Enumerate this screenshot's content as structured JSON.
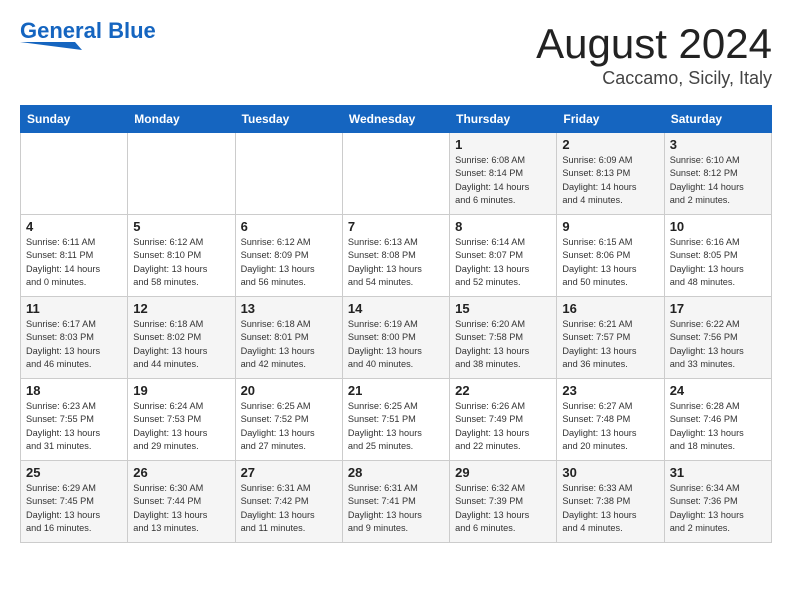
{
  "header": {
    "logo_line1": "General",
    "logo_line2": "Blue",
    "month": "August 2024",
    "location": "Caccamo, Sicily, Italy"
  },
  "weekdays": [
    "Sunday",
    "Monday",
    "Tuesday",
    "Wednesday",
    "Thursday",
    "Friday",
    "Saturday"
  ],
  "weeks": [
    [
      {
        "day": "",
        "info": ""
      },
      {
        "day": "",
        "info": ""
      },
      {
        "day": "",
        "info": ""
      },
      {
        "day": "",
        "info": ""
      },
      {
        "day": "1",
        "info": "Sunrise: 6:08 AM\nSunset: 8:14 PM\nDaylight: 14 hours\nand 6 minutes."
      },
      {
        "day": "2",
        "info": "Sunrise: 6:09 AM\nSunset: 8:13 PM\nDaylight: 14 hours\nand 4 minutes."
      },
      {
        "day": "3",
        "info": "Sunrise: 6:10 AM\nSunset: 8:12 PM\nDaylight: 14 hours\nand 2 minutes."
      }
    ],
    [
      {
        "day": "4",
        "info": "Sunrise: 6:11 AM\nSunset: 8:11 PM\nDaylight: 14 hours\nand 0 minutes."
      },
      {
        "day": "5",
        "info": "Sunrise: 6:12 AM\nSunset: 8:10 PM\nDaylight: 13 hours\nand 58 minutes."
      },
      {
        "day": "6",
        "info": "Sunrise: 6:12 AM\nSunset: 8:09 PM\nDaylight: 13 hours\nand 56 minutes."
      },
      {
        "day": "7",
        "info": "Sunrise: 6:13 AM\nSunset: 8:08 PM\nDaylight: 13 hours\nand 54 minutes."
      },
      {
        "day": "8",
        "info": "Sunrise: 6:14 AM\nSunset: 8:07 PM\nDaylight: 13 hours\nand 52 minutes."
      },
      {
        "day": "9",
        "info": "Sunrise: 6:15 AM\nSunset: 8:06 PM\nDaylight: 13 hours\nand 50 minutes."
      },
      {
        "day": "10",
        "info": "Sunrise: 6:16 AM\nSunset: 8:05 PM\nDaylight: 13 hours\nand 48 minutes."
      }
    ],
    [
      {
        "day": "11",
        "info": "Sunrise: 6:17 AM\nSunset: 8:03 PM\nDaylight: 13 hours\nand 46 minutes."
      },
      {
        "day": "12",
        "info": "Sunrise: 6:18 AM\nSunset: 8:02 PM\nDaylight: 13 hours\nand 44 minutes."
      },
      {
        "day": "13",
        "info": "Sunrise: 6:18 AM\nSunset: 8:01 PM\nDaylight: 13 hours\nand 42 minutes."
      },
      {
        "day": "14",
        "info": "Sunrise: 6:19 AM\nSunset: 8:00 PM\nDaylight: 13 hours\nand 40 minutes."
      },
      {
        "day": "15",
        "info": "Sunrise: 6:20 AM\nSunset: 7:58 PM\nDaylight: 13 hours\nand 38 minutes."
      },
      {
        "day": "16",
        "info": "Sunrise: 6:21 AM\nSunset: 7:57 PM\nDaylight: 13 hours\nand 36 minutes."
      },
      {
        "day": "17",
        "info": "Sunrise: 6:22 AM\nSunset: 7:56 PM\nDaylight: 13 hours\nand 33 minutes."
      }
    ],
    [
      {
        "day": "18",
        "info": "Sunrise: 6:23 AM\nSunset: 7:55 PM\nDaylight: 13 hours\nand 31 minutes."
      },
      {
        "day": "19",
        "info": "Sunrise: 6:24 AM\nSunset: 7:53 PM\nDaylight: 13 hours\nand 29 minutes."
      },
      {
        "day": "20",
        "info": "Sunrise: 6:25 AM\nSunset: 7:52 PM\nDaylight: 13 hours\nand 27 minutes."
      },
      {
        "day": "21",
        "info": "Sunrise: 6:25 AM\nSunset: 7:51 PM\nDaylight: 13 hours\nand 25 minutes."
      },
      {
        "day": "22",
        "info": "Sunrise: 6:26 AM\nSunset: 7:49 PM\nDaylight: 13 hours\nand 22 minutes."
      },
      {
        "day": "23",
        "info": "Sunrise: 6:27 AM\nSunset: 7:48 PM\nDaylight: 13 hours\nand 20 minutes."
      },
      {
        "day": "24",
        "info": "Sunrise: 6:28 AM\nSunset: 7:46 PM\nDaylight: 13 hours\nand 18 minutes."
      }
    ],
    [
      {
        "day": "25",
        "info": "Sunrise: 6:29 AM\nSunset: 7:45 PM\nDaylight: 13 hours\nand 16 minutes."
      },
      {
        "day": "26",
        "info": "Sunrise: 6:30 AM\nSunset: 7:44 PM\nDaylight: 13 hours\nand 13 minutes."
      },
      {
        "day": "27",
        "info": "Sunrise: 6:31 AM\nSunset: 7:42 PM\nDaylight: 13 hours\nand 11 minutes."
      },
      {
        "day": "28",
        "info": "Sunrise: 6:31 AM\nSunset: 7:41 PM\nDaylight: 13 hours\nand 9 minutes."
      },
      {
        "day": "29",
        "info": "Sunrise: 6:32 AM\nSunset: 7:39 PM\nDaylight: 13 hours\nand 6 minutes."
      },
      {
        "day": "30",
        "info": "Sunrise: 6:33 AM\nSunset: 7:38 PM\nDaylight: 13 hours\nand 4 minutes."
      },
      {
        "day": "31",
        "info": "Sunrise: 6:34 AM\nSunset: 7:36 PM\nDaylight: 13 hours\nand 2 minutes."
      }
    ]
  ]
}
